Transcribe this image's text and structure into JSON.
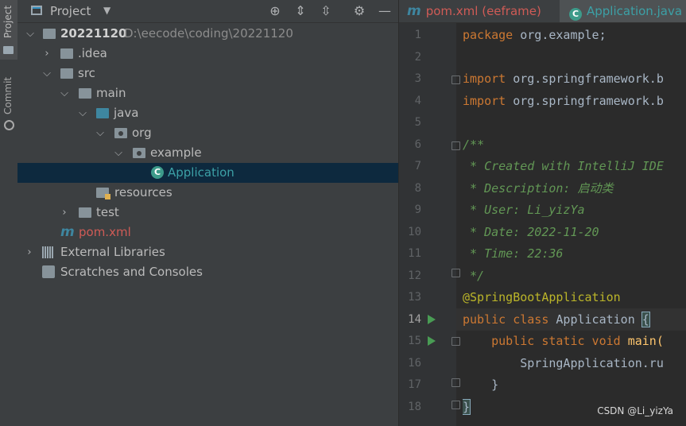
{
  "sidebar": {
    "project_tab": "Project",
    "commit_tab": "Commit"
  },
  "project_panel": {
    "title": "Project",
    "tree": [
      {
        "label": "20221120",
        "path": "D:\\eecode\\coding\\20221120"
      },
      {
        "label": ".idea"
      },
      {
        "label": "src"
      },
      {
        "label": "main"
      },
      {
        "label": "java"
      },
      {
        "label": "org"
      },
      {
        "label": "example"
      },
      {
        "label": "Application"
      },
      {
        "label": "resources"
      },
      {
        "label": "test"
      },
      {
        "label": "pom.xml"
      },
      {
        "label": "External Libraries"
      },
      {
        "label": "Scratches and Consoles"
      }
    ]
  },
  "editor": {
    "tabs": [
      {
        "icon": "m",
        "label": "pom.xml (eeframe)"
      },
      {
        "icon": "C",
        "label": "Application.java"
      }
    ],
    "line_numbers": [
      "1",
      "2",
      "3",
      "4",
      "5",
      "6",
      "7",
      "8",
      "9",
      "10",
      "11",
      "12",
      "13",
      "14",
      "15",
      "16",
      "17",
      "18"
    ],
    "code": {
      "l1_kw": "package",
      "l1_rest": " org.example;",
      "l3_kw": "import",
      "l3_rest": " org.springframework.b",
      "l4_kw": "import",
      "l4_rest": " org.springframework.b",
      "l6": "/**",
      "l7": " * Created with IntelliJ IDE",
      "l8": " * Description: 启动类",
      "l9": " * User: Li_yizYa",
      "l10": " * Date: 2022-11-20",
      "l11": " * Time: 22:36",
      "l12": " */",
      "l13": "@SpringBootApplication",
      "l14_kw": "public class",
      "l14_name": " Application ",
      "l14_brace": "{",
      "l15_kw": "    public static void",
      "l15_fn": " main(",
      "l16": "        SpringApplication.ru",
      "l17": "    }",
      "l18": "}"
    }
  },
  "watermark": "CSDN @Li_yizYa"
}
